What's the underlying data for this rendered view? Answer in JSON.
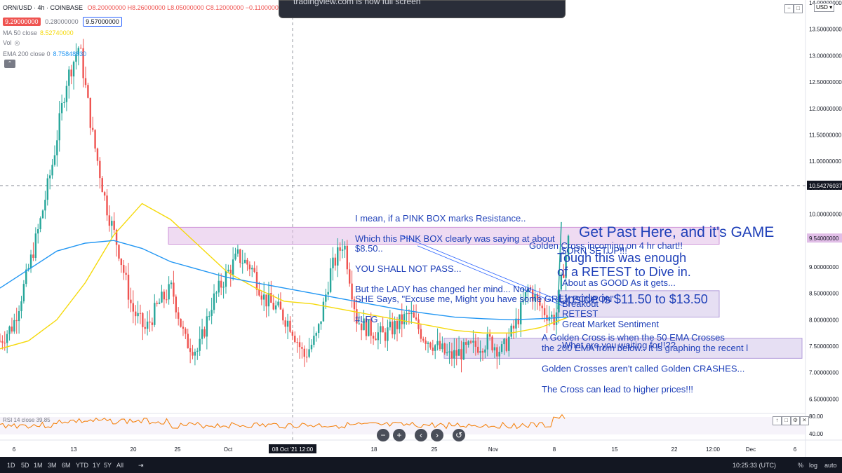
{
  "header": {
    "symbol": "ORN/USD · 4h · COINBASE",
    "ohlc": "O8.20000000 H8.26000000 L8.05000000 C8.12000000 −0.11000000",
    "bid": "9.29000000",
    "spread": "0.28000000",
    "ask": "9.57000000",
    "ma50": "MA 50 close",
    "ma50_val": "8.52740000",
    "vol": "Vol",
    "ema200": "EMA 200 close 0",
    "ema200_val": "8.75848830",
    "currency": "USD"
  },
  "top_popup": {
    "text": "tradingview.com is now full screen"
  },
  "chart_data": {
    "type": "line",
    "title": "ORN/USD · 4h · COINBASE",
    "xlabel": "",
    "ylabel": "",
    "ylim": [
      6.2,
      14.0
    ],
    "y_ticks": [
      "14.00000000",
      "13.50000000",
      "13.00000000",
      "12.50000000",
      "12.00000000",
      "11.50000000",
      "11.00000000",
      "10.50000000",
      "10.00000000",
      "9.50000000",
      "9.00000000",
      "8.50000000",
      "8.00000000",
      "7.50000000",
      "7.00000000",
      "6.50000000"
    ],
    "x_ticks": [
      "6",
      "13",
      "20",
      "25",
      "Oct",
      "18",
      "25",
      "Nov",
      "8",
      "15",
      "22",
      "12:00",
      "Dec",
      "6"
    ],
    "x_tick_highlight": "08 Oct '21  12:00",
    "price_labels": {
      "crosshair": "10.54276037",
      "last": "9.54000000"
    },
    "series": [
      {
        "name": "MA 50 close",
        "color": "#f5d90a",
        "values": [
          7.45,
          7.6,
          8.0,
          8.7,
          9.6,
          10.2,
          9.9,
          9.4,
          8.9,
          8.6,
          8.35,
          8.3,
          8.2,
          8.1,
          8.0,
          7.9,
          7.8,
          7.75,
          7.75,
          7.85,
          8.05
        ]
      },
      {
        "name": "EMA 200 close 0",
        "color": "#2196f3",
        "values": [
          8.6,
          8.95,
          9.3,
          9.45,
          9.5,
          9.35,
          9.1,
          8.95,
          8.8,
          8.7,
          8.6,
          8.5,
          8.4,
          8.3,
          8.2,
          8.12,
          8.05,
          8.02,
          8.0,
          8.02,
          8.05
        ]
      }
    ],
    "price_path": [
      7.6,
      7.9,
      8.8,
      9.8,
      11.0,
      12.5,
      13.2,
      11.5,
      10.2,
      9.3,
      8.2,
      7.8,
      8.3,
      8.6,
      7.6,
      7.4,
      8.3,
      8.8,
      9.2,
      9.0,
      8.4,
      8.2,
      7.9,
      7.3,
      7.7,
      8.9,
      9.5,
      8.0,
      7.8,
      7.7,
      7.9,
      8.1,
      7.7,
      7.5,
      7.3,
      7.4,
      7.5,
      7.6,
      7.4,
      7.9,
      8.6,
      8.2,
      8.0,
      9.5
    ],
    "rsi": {
      "label": "RSI 14 close",
      "value": "39.85",
      "upper": "80.00",
      "lower": "40.00"
    }
  },
  "annotations": {
    "pink_note": [
      "I mean, if a PINK BOX marks Resistance..",
      "",
      "Which this PINK BOX clearly was saying at about",
      "$8.50..",
      "",
      "YOU SHALL NOT PASS...",
      "",
      "But the LADY has changed her mind...  Now",
      "SHE Says, \"Excuse me, Might you have some GREY POUPON\"",
      "",
      "#LFG"
    ],
    "get_past": "Get Past Here, and it's GAME",
    "orn_setup": "$ORN SETUP!!!",
    "tough_enough": "Tough this was enough",
    "retest_dive": "of a RETEST to Dive in.",
    "golden_cross_4h": "Golden Cross incoming on 4 hr chart!!",
    "about_good": "About as GOOD As it gets...",
    "upside": "Upside is $11.50 to $13.50",
    "breakout": "Breakout",
    "retest": "RETEST",
    "sentiment": "Great Market Sentiment",
    "what_waiting": "What are you waiting for!!??",
    "golden_note": [
      "A Golden Cross is when the 50 EMA Crosses",
      "the 200 EMA from below..   It is graphing the  recent l",
      "",
      "Golden Crosses aren't called Golden CRASHES...",
      "",
      "The Cross can lead to higher prices!!!"
    ]
  },
  "bottom_bar": {
    "timeframes": [
      "1D",
      "5D",
      "1M",
      "3M",
      "6M",
      "YTD",
      "1Y",
      "5Y",
      "All"
    ],
    "time": "10:25:33 (UTC)",
    "pct": "%",
    "log": "log",
    "auto": "auto"
  },
  "colors": {
    "up": "#26a69a",
    "down": "#ef5350",
    "pink_box": "#e1bee7",
    "grey_box": "#d1c4e9",
    "annotation_text": "#1e3fb8"
  }
}
